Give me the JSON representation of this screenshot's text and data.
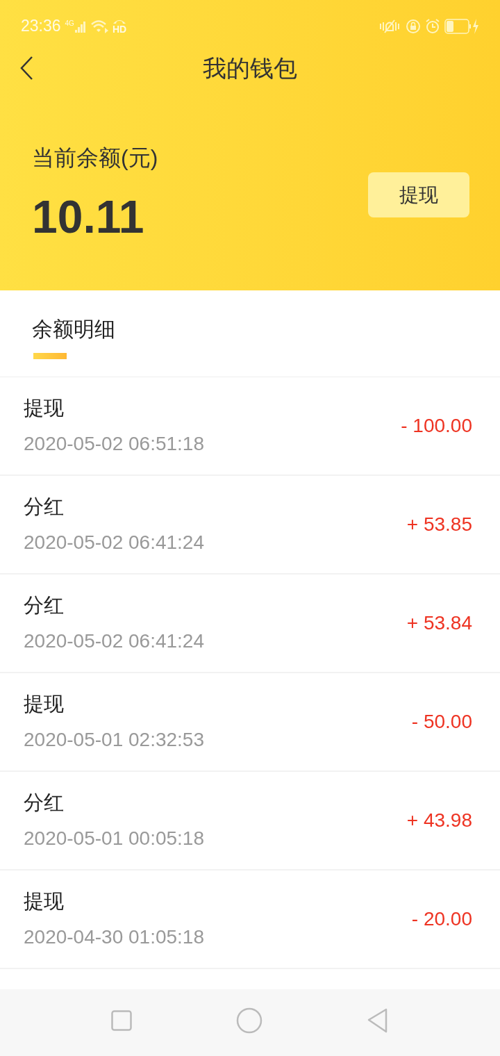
{
  "status_bar": {
    "time": "23:36",
    "network": "4G",
    "call_badge": "HD"
  },
  "header": {
    "title": "我的钱包"
  },
  "balance": {
    "label": "当前余额(元)",
    "amount": "10.11",
    "button": "提现"
  },
  "section": {
    "title": "余额明细",
    "selected": true
  },
  "records": [
    {
      "title": "提现",
      "time": "2020-05-02 06:51:18",
      "amount": "- 100.00"
    },
    {
      "title": "分红",
      "time": "2020-05-02 06:41:24",
      "amount": "+ 53.85"
    },
    {
      "title": "分红",
      "time": "2020-05-02 06:41:24",
      "amount": "+ 53.84"
    },
    {
      "title": "提现",
      "time": "2020-05-01 02:32:53",
      "amount": "- 50.00"
    },
    {
      "title": "分红",
      "time": "2020-05-01 00:05:18",
      "amount": "+ 43.98"
    },
    {
      "title": "提现",
      "time": "2020-04-30 01:05:18",
      "amount": "- 20.00"
    }
  ]
}
